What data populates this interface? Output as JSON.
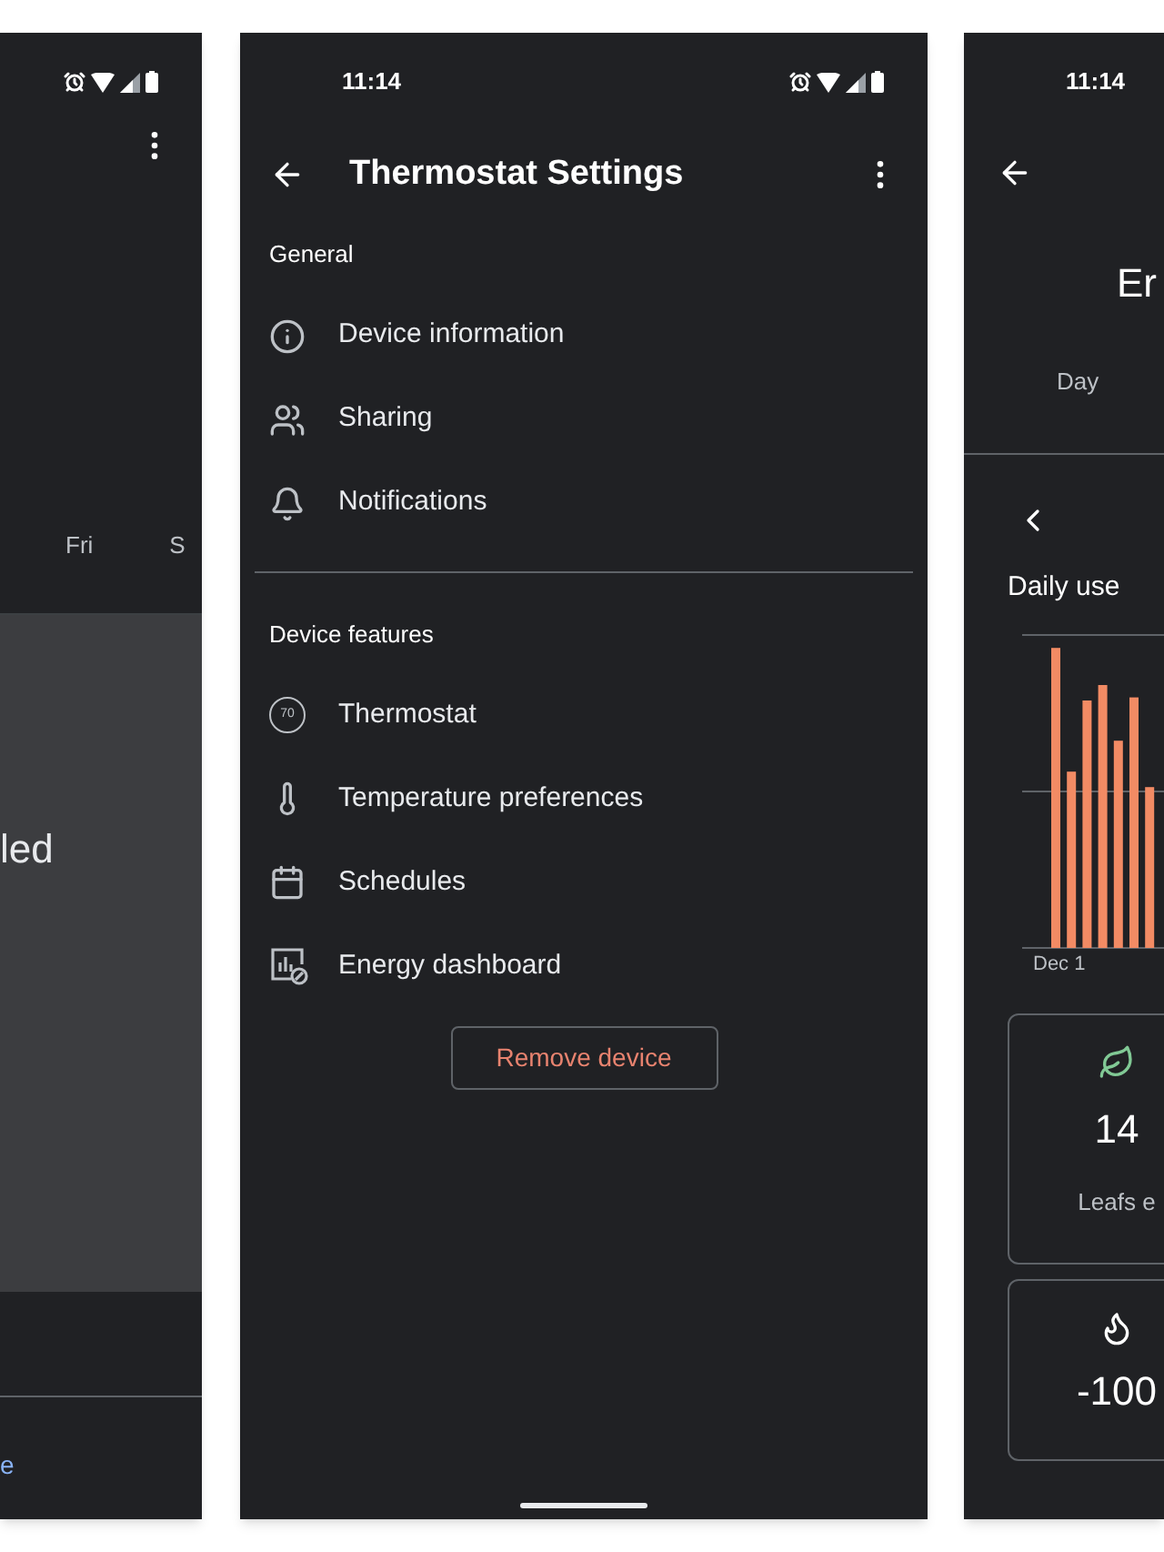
{
  "left_screen": {
    "days": [
      "Fri",
      "S"
    ],
    "card_text": "led",
    "link": "e"
  },
  "center_screen": {
    "status_bar": {
      "time": "11:14"
    },
    "title": "Thermostat Settings",
    "sections": [
      {
        "heading": "General",
        "items": [
          {
            "label": "Device information"
          },
          {
            "label": "Sharing"
          },
          {
            "label": "Notifications"
          }
        ]
      },
      {
        "heading": "Device features",
        "items": [
          {
            "label": "Thermostat",
            "icon_text": "70"
          },
          {
            "label": "Temperature preferences"
          },
          {
            "label": "Schedules"
          },
          {
            "label": "Energy dashboard"
          }
        ]
      }
    ],
    "remove_button": "Remove device"
  },
  "right_screen": {
    "status_bar": {
      "time": "11:14"
    },
    "title": "Er",
    "tab": "Day",
    "chart_title": "Daily use",
    "chart_start_label": "Dec 1",
    "cards": [
      {
        "value": "14",
        "caption": "Leafs e"
      },
      {
        "value": "-100"
      }
    ]
  }
}
